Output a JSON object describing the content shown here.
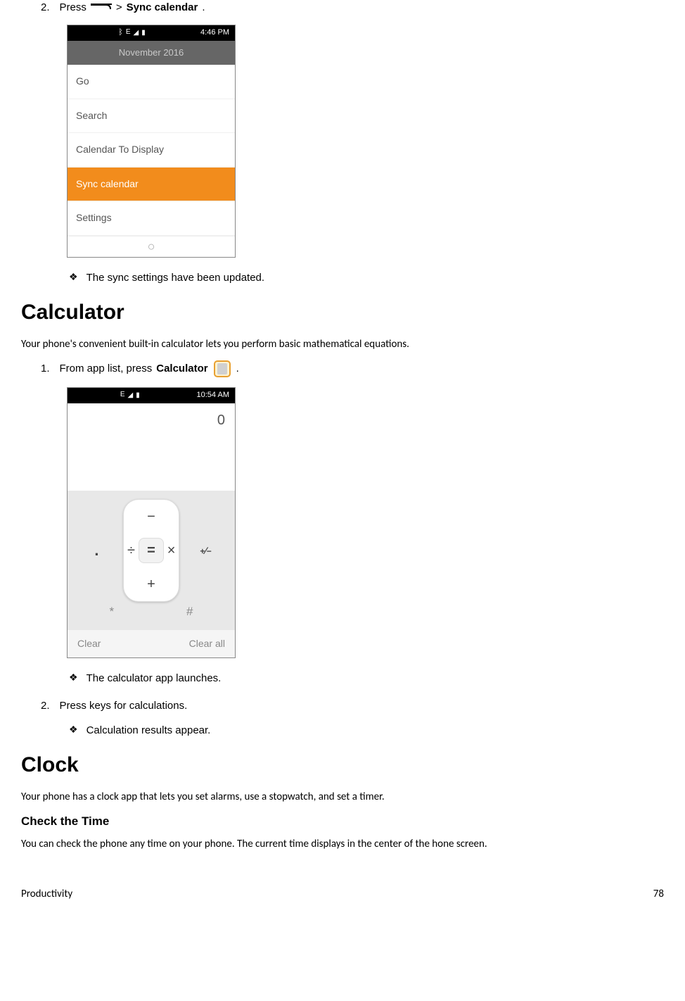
{
  "step1": {
    "num": "2.",
    "prefix": "Press",
    "gt": ">",
    "target": "Sync calendar",
    "period": "."
  },
  "phone1": {
    "status": {
      "bt": "ᛒ",
      "e": "E",
      "time": "4:46 PM"
    },
    "header": "November 2016",
    "items": [
      "Go",
      "Search",
      "Calendar To Display",
      "Sync calendar",
      "Settings"
    ],
    "selected_index": 3
  },
  "bullet1": "The sync settings have been updated.",
  "calc_section": {
    "title": "Calculator",
    "intro": "Your phone's convenient built-in calculator lets you perform basic mathematical equations.",
    "step_num": "1.",
    "step_prefix": "From app list, press",
    "step_bold": "Calculator",
    "step_period": "."
  },
  "phone2": {
    "status": {
      "e": "E",
      "time": "10:54 AM"
    },
    "display": "0",
    "keys": {
      "dot": ".",
      "star": "*",
      "sign": "±",
      "hash": "#",
      "minus": "−",
      "plus": "+",
      "div": "÷",
      "mul": "×",
      "eq": "="
    },
    "clear": "Clear",
    "clearall": "Clear all"
  },
  "bullet2": "The calculator app launches.",
  "step2b": {
    "num": "2.",
    "text": "Press keys for calculations."
  },
  "bullet3": "Calculation results appear.",
  "clock_section": {
    "title": "Clock",
    "intro": "Your phone has a clock app that lets you set alarms, use a stopwatch, and set a timer.",
    "sub": "Check the Time",
    "subtext": "You can check the phone any time on your phone. The current time displays in the center of the hone screen."
  },
  "footer": {
    "left": "Productivity",
    "right": "78"
  }
}
